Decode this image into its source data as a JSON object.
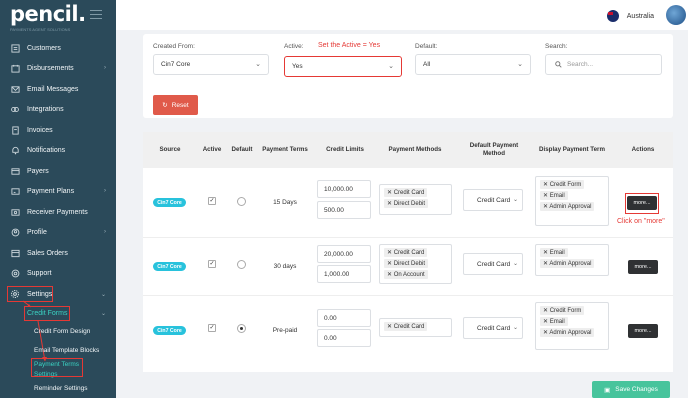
{
  "app": {
    "logo": "pencil.",
    "logo_sub": "PAYMENTS AGENT SOLUTIONS"
  },
  "topbar": {
    "country": "Australia"
  },
  "sidebar": {
    "items": [
      {
        "label": "Customers",
        "icon": "customers-icon"
      },
      {
        "label": "Disbursements",
        "icon": "disbursements-icon",
        "chevron": "›"
      },
      {
        "label": "Email Messages",
        "icon": "email-icon"
      },
      {
        "label": "Integrations",
        "icon": "integrations-icon"
      },
      {
        "label": "Invoices",
        "icon": "invoices-icon"
      },
      {
        "label": "Notifications",
        "icon": "bell-icon"
      },
      {
        "label": "Payers",
        "icon": "payers-icon"
      },
      {
        "label": "Payment Plans",
        "icon": "payment-plans-icon",
        "chevron": "›"
      },
      {
        "label": "Receiver Payments",
        "icon": "receiver-payments-icon"
      },
      {
        "label": "Profile",
        "icon": "profile-icon",
        "chevron": "›"
      },
      {
        "label": "Sales Orders",
        "icon": "sales-orders-icon"
      },
      {
        "label": "Support",
        "icon": "support-icon"
      },
      {
        "label": "Settings",
        "icon": "gear-icon",
        "chevron": "⌄"
      }
    ],
    "credit_forms": "Credit Forms",
    "sub_items": [
      "Credit Form Design",
      "Email Template Blocks",
      "Payment Terms",
      "Settings",
      "Reminder Settings"
    ]
  },
  "filters": {
    "created_from": {
      "label": "Created From:",
      "value": "Cin7 Core"
    },
    "active": {
      "label": "Active:",
      "value": "Yes"
    },
    "default": {
      "label": "Default:",
      "value": "All"
    },
    "search": {
      "label": "Search:",
      "placeholder": "Search..."
    },
    "reset": "Reset"
  },
  "annotations": {
    "active_note": "Set the Active = Yes",
    "more_note": "Click on \"more\""
  },
  "table": {
    "headers": [
      "Source",
      "Active",
      "Default",
      "Payment Terms",
      "Credit Limits",
      "Payment Methods",
      "Default Payment Method",
      "Display Payment Term",
      "Actions"
    ],
    "rows": [
      {
        "source": "Cin7 Core",
        "active": true,
        "default": false,
        "payment_terms": "15 Days",
        "credit_limits": [
          "10,000.00",
          "500.00"
        ],
        "payment_methods": [
          "Credit Card",
          "Direct Debit"
        ],
        "default_payment_method": "Credit Card",
        "display_terms": [
          "Credit Form",
          "Email",
          "Admin Approval"
        ],
        "action": "more..."
      },
      {
        "source": "Cin7 Core",
        "active": true,
        "default": false,
        "payment_terms": "30 days",
        "credit_limits": [
          "20,000.00",
          "1,000.00"
        ],
        "payment_methods": [
          "Credit Card",
          "Direct Debit",
          "On Account"
        ],
        "default_payment_method": "Credit Card",
        "display_terms": [
          "Email",
          "Admin Approval"
        ],
        "action": "more..."
      },
      {
        "source": "Cin7 Core",
        "active": true,
        "default": true,
        "payment_terms": "Pre-paid",
        "credit_limits": [
          "0.00",
          "0.00"
        ],
        "payment_methods": [
          "Credit Card"
        ],
        "default_payment_method": "Credit Card",
        "display_terms": [
          "Credit Form",
          "Email",
          "Admin Approval"
        ],
        "action": "more..."
      }
    ]
  },
  "save_button": "Save Changes",
  "colors": {
    "sidebar": "#2b4a5a",
    "accent_teal": "#3ad3c3",
    "badge": "#28c2dc",
    "reset": "#e05a4a",
    "save": "#47c49c",
    "annotation": "#e53935"
  }
}
